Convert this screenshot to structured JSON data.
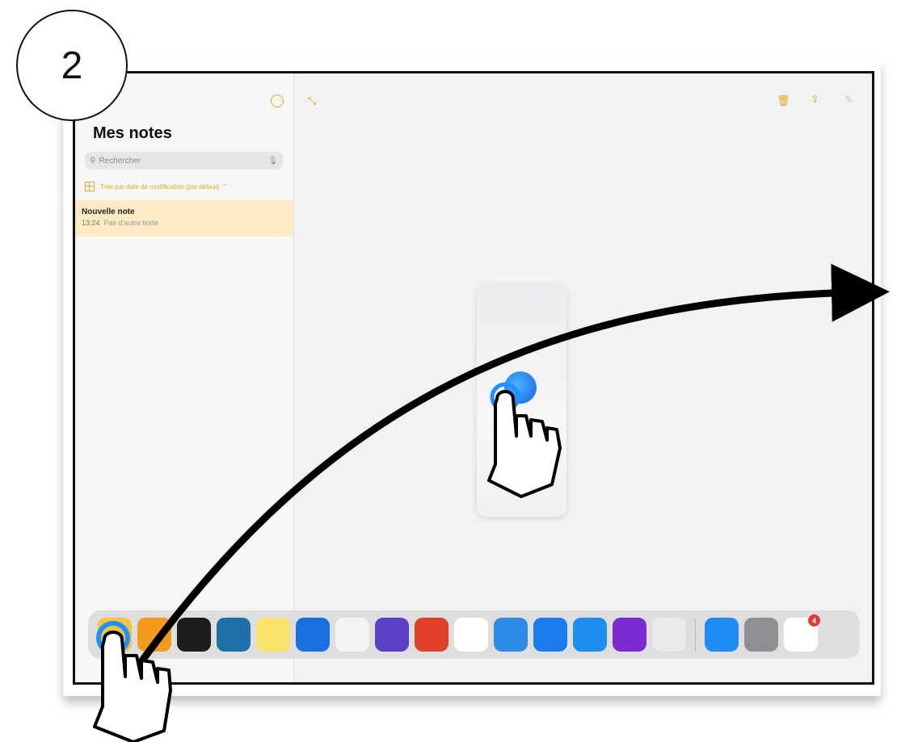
{
  "step": {
    "number": "2"
  },
  "sidebar": {
    "title": "Mes notes",
    "search_placeholder": "Rechercher",
    "sort_label": "Trier par date de modification (par défaut)",
    "notes": [
      {
        "title": "Nouvelle note",
        "time": "13:24",
        "preview": "Pas d'autre texte"
      }
    ]
  },
  "toolbar": {
    "icons": [
      "more-icon",
      "expand-icon",
      "trash-icon",
      "share-icon",
      "compose-icon"
    ]
  },
  "dock": {
    "apps": [
      {
        "name": "notes-app-icon",
        "color": "#f5c242"
      },
      {
        "name": "pages-app-icon",
        "color": "#f29b1d"
      },
      {
        "name": "procreate-app-icon",
        "color": "#1d1d1d"
      },
      {
        "name": "affinity-designer-app-icon",
        "color": "#1f6fa8"
      },
      {
        "name": "notes-yellow-app-icon",
        "color": "#f9e36a"
      },
      {
        "name": "spark-app-icon",
        "color": "#1a6fe0"
      },
      {
        "name": "epsilon-app-icon",
        "color": "#f3f3f3"
      },
      {
        "name": "imovie-app-icon",
        "color": "#5b3fc4"
      },
      {
        "name": "creative-cloud-app-icon",
        "color": "#e0402b"
      },
      {
        "name": "photos-app-icon",
        "color": "#ffffff"
      },
      {
        "name": "files-app-icon",
        "color": "#2f8ce6"
      },
      {
        "name": "keynote-app-icon",
        "color": "#1b7cf0"
      },
      {
        "name": "notability-app-icon",
        "color": "#1e8ef2"
      },
      {
        "name": "book-creator-app-icon",
        "color": "#7b2bd1"
      },
      {
        "name": "launchpad-app-icon",
        "color": "#e9e9e9"
      },
      {
        "name": "app-store-app-icon",
        "color": "#1f8bf5"
      },
      {
        "name": "settings-app-icon",
        "color": "#8e8e93"
      },
      {
        "name": "gmail-app-icon",
        "color": "#ffffff",
        "badge": "4"
      }
    ]
  },
  "colors": {
    "accent": "#e2a81a",
    "note_highlight": "#faebc5",
    "gesture_stroke": "#000000"
  }
}
